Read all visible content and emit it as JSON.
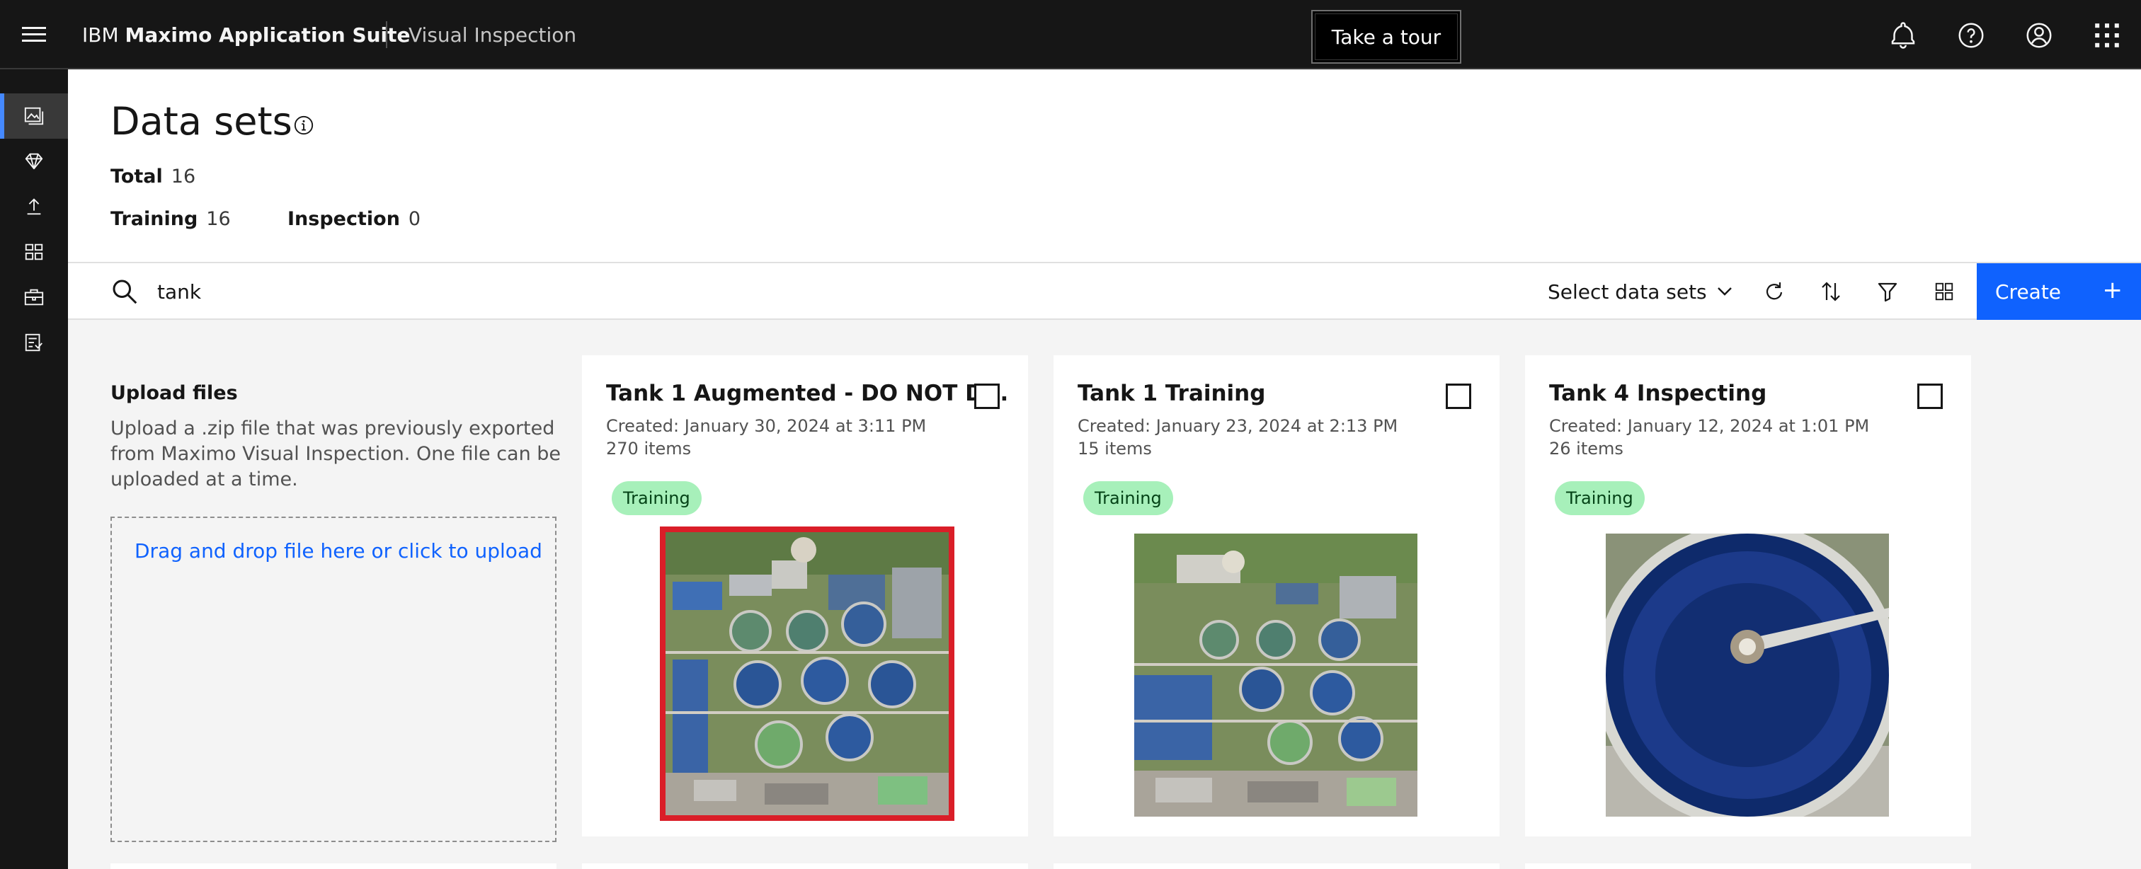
{
  "header": {
    "brand_prefix": "IBM",
    "brand_bold": "Maximo Application Suite",
    "product": "Visual Inspection",
    "tour_label": "Take a tour",
    "icons": [
      "notification-icon",
      "help-icon",
      "user-icon",
      "app-switcher-icon"
    ]
  },
  "rail": {
    "items": [
      "data-sets-icon",
      "models-icon",
      "deploy-icon",
      "projects-icon",
      "toolkit-icon",
      "reports-icon"
    ],
    "active_index": 0
  },
  "page": {
    "title": "Data sets",
    "total_label": "Total",
    "total_value": "16",
    "training_label": "Training",
    "training_value": "16",
    "inspection_label": "Inspection",
    "inspection_value": "0"
  },
  "toolbar": {
    "search_value": "tank",
    "select_label": "Select data sets",
    "create_label": "Create",
    "create_plus": "+",
    "icons": [
      "refresh-icon",
      "sort-icon",
      "filter-icon",
      "grid-view-icon"
    ]
  },
  "upload": {
    "title": "Upload files",
    "description": "Upload a .zip file that was previously exported from Maximo Visual Inspection. One file can be uploaded at a time.",
    "dropzone_label": "Drag and drop file here or click to upload"
  },
  "cards": [
    {
      "title": "Tank 1 Augmented - DO NOT D...",
      "created": "Created: January 30, 2024 at 3:11 PM",
      "items": "270 items",
      "tag": "Training",
      "image": "aerial-water-treatment-plant",
      "selected": true
    },
    {
      "title": "Tank 1 Training",
      "created": "Created: January 23, 2024 at 2:13 PM",
      "items": "15 items",
      "tag": "Training",
      "image": "aerial-water-treatment-plant",
      "selected": false
    },
    {
      "title": "Tank 4 Inspecting",
      "created": "Created: January 12, 2024 at 1:01 PM",
      "items": "26 items",
      "tag": "Training",
      "image": "circular-clarifier-tank",
      "selected": false
    }
  ],
  "colors": {
    "accent": "#0f62fe",
    "header_bg": "#161616",
    "tag_bg": "#a7f0ba",
    "selected_outline": "#da1e28"
  }
}
